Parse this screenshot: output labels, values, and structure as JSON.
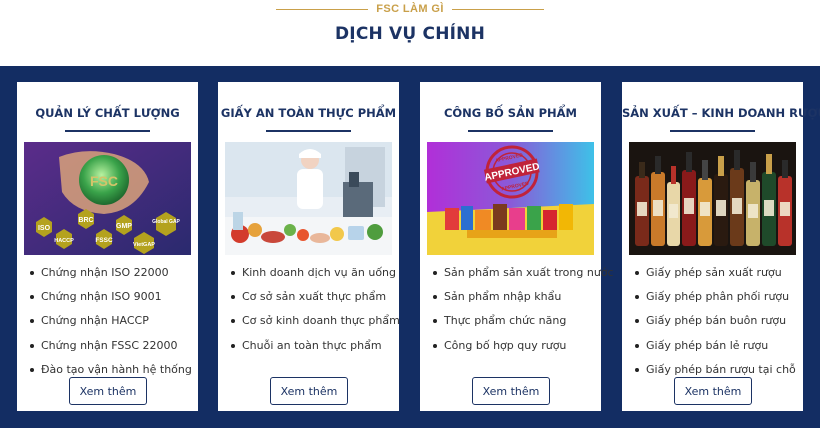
{
  "header": {
    "eyebrow": "FSC LÀM GÌ",
    "title": "DỊCH VỤ CHÍNH"
  },
  "cards": [
    {
      "title": "QUẢN LÝ CHẤT LƯỢNG",
      "items": [
        "Chứng nhận ISO 22000",
        "Chứng nhận ISO 9001",
        "Chứng nhận HACCP",
        "Chứng nhận FSSC 22000",
        "Đào tạo vận hành hệ thống"
      ],
      "button": "Xem thêm",
      "image_labels": [
        "ISO",
        "BRC",
        "GMP",
        "Global GAP",
        "HACCP",
        "FSSC",
        "VietGAP",
        "FSC"
      ]
    },
    {
      "title": "GIẤY AN TOÀN THỰC PHẨM",
      "items": [
        "Kinh doanh dịch vụ ăn uống",
        "Cơ sở sản xuất thực phẩm",
        "Cơ sở kinh doanh thực phẩm",
        "Chuỗi an toàn thực phẩm"
      ],
      "button": "Xem thêm"
    },
    {
      "title": "CÔNG BỐ SẢN PHẨM",
      "items": [
        "Sản phẩm sản xuất trong nước",
        "Sản phẩm nhập khẩu",
        "Thực phẩm chức năng",
        "Công bố hợp quy rượu"
      ],
      "button": "Xem thêm",
      "image_labels": [
        "APPROVED",
        "APPROVED",
        "APPROVED"
      ]
    },
    {
      "title": "SẢN XUẤT – KINH DOANH RƯỢU",
      "items": [
        "Giấy phép sản xuất rượu",
        "Giấy phép phân phối rượu",
        "Giấy phép bán buôn rượu",
        "Giấy phép bán lẻ rượu",
        "Giấy phép bán rượu tại chỗ"
      ],
      "button": "Xem thêm"
    }
  ],
  "colors": {
    "navy": "#132d63",
    "title_navy": "#1c3364",
    "gold": "#c9a04a"
  }
}
